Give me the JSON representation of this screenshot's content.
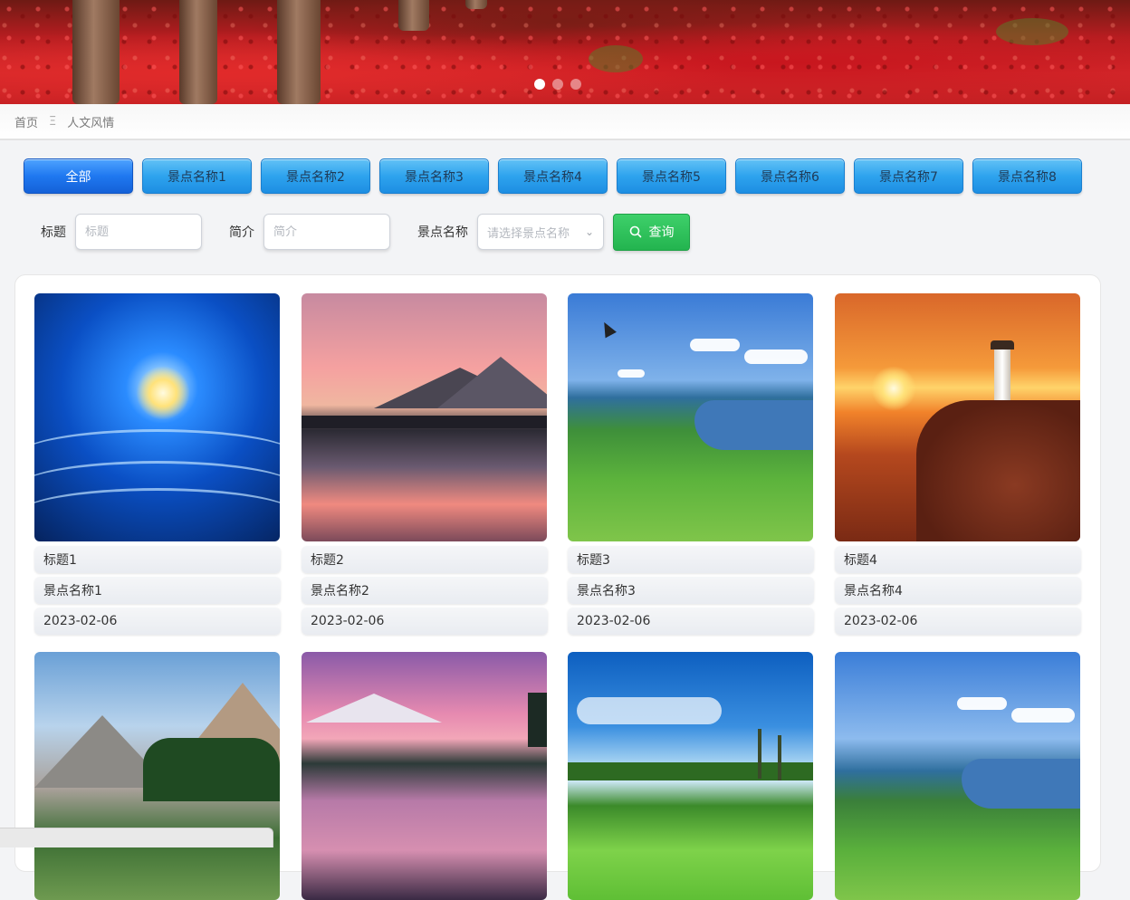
{
  "carousel": {
    "slides": 3,
    "active_index": 0
  },
  "breadcrumb": {
    "home": "首页",
    "separator": "Ξ",
    "current": "人文风情"
  },
  "categories": [
    {
      "label": "全部",
      "active": true
    },
    {
      "label": "景点名称1",
      "active": false
    },
    {
      "label": "景点名称2",
      "active": false
    },
    {
      "label": "景点名称3",
      "active": false
    },
    {
      "label": "景点名称4",
      "active": false
    },
    {
      "label": "景点名称5",
      "active": false
    },
    {
      "label": "景点名称6",
      "active": false
    },
    {
      "label": "景点名称7",
      "active": false
    },
    {
      "label": "景点名称8",
      "active": false
    }
  ],
  "search": {
    "title_label": "标题",
    "title_placeholder": "标题",
    "intro_label": "简介",
    "intro_placeholder": "简介",
    "spot_label": "景点名称",
    "spot_placeholder": "请选择景点名称",
    "query_label": "查询"
  },
  "cards": [
    {
      "title": "标题1",
      "spot": "景点名称1",
      "date": "2023-02-06",
      "photo": "blue-sun-waves"
    },
    {
      "title": "标题2",
      "spot": "景点名称2",
      "date": "2023-02-06",
      "photo": "pink-lake-sunset"
    },
    {
      "title": "标题3",
      "spot": "景点名称3",
      "date": "2023-02-06",
      "photo": "green-hills-lake"
    },
    {
      "title": "标题4",
      "spot": "景点名称4",
      "date": "2023-02-06",
      "photo": "lighthouse-sunset"
    },
    {
      "title": "",
      "spot": "",
      "date": "",
      "photo": "alpine-cabin"
    },
    {
      "title": "",
      "spot": "",
      "date": "",
      "photo": "mount-fuji-lake"
    },
    {
      "title": "",
      "spot": "",
      "date": "",
      "photo": "palm-golf-field"
    },
    {
      "title": "",
      "spot": "",
      "date": "",
      "photo": "green-hills-lake"
    }
  ],
  "colors": {
    "category_button": "#2ea3ee",
    "category_button_active": "#1f78f0",
    "query_button": "#23b44f"
  }
}
